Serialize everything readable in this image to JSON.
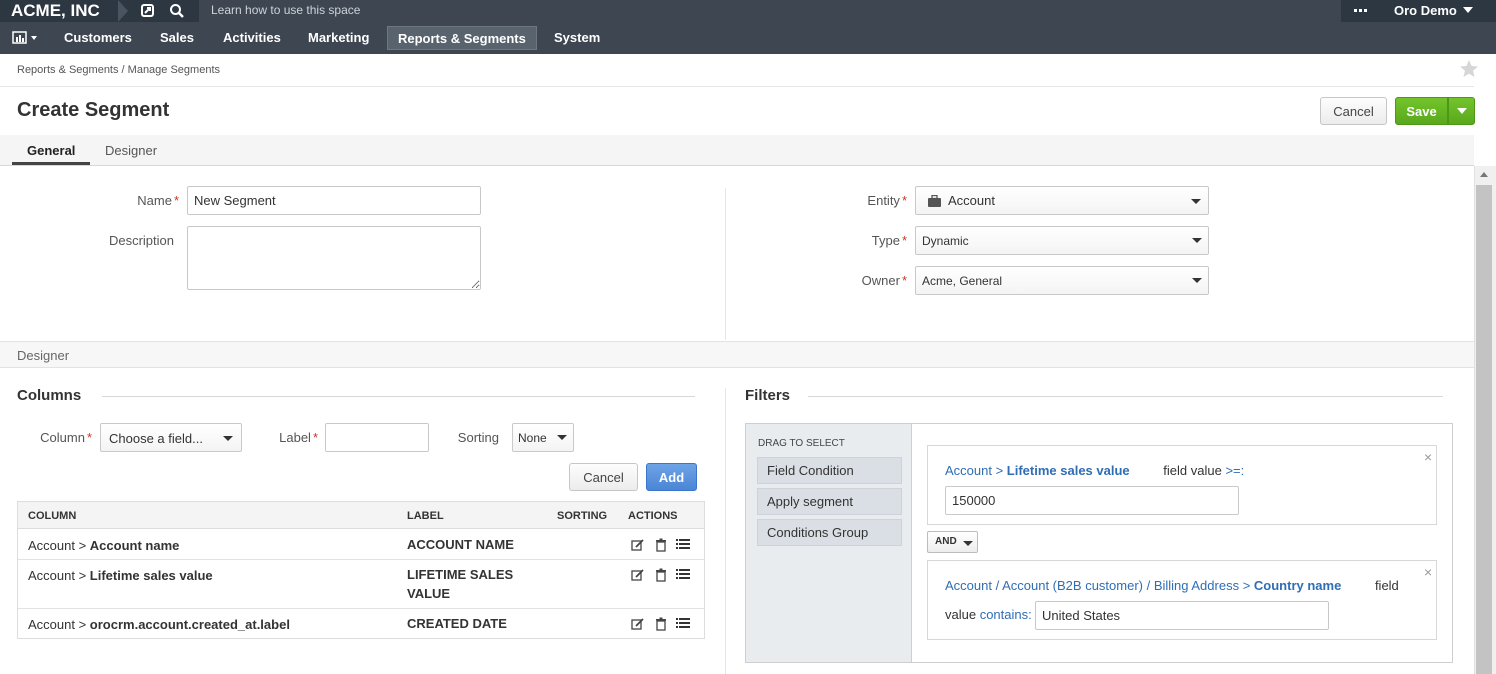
{
  "topbar": {
    "company": "ACME, INC",
    "search_placeholder": "Learn how to use this space",
    "user": "Oro Demo"
  },
  "nav": {
    "items": [
      "Customers",
      "Sales",
      "Activities",
      "Marketing",
      "Reports & Segments",
      "System"
    ],
    "active": "Reports & Segments"
  },
  "breadcrumb": "Reports & Segments / Manage Segments",
  "page": {
    "title": "Create Segment",
    "cancel_label": "Cancel",
    "save_label": "Save"
  },
  "tabs": [
    "General",
    "Designer"
  ],
  "general": {
    "name_label": "Name",
    "name_value": "New Segment",
    "description_label": "Description",
    "description_value": "",
    "entity_label": "Entity",
    "entity_value": "Account",
    "type_label": "Type",
    "type_value": "Dynamic",
    "owner_label": "Owner",
    "owner_value": "Acme, General"
  },
  "designer": {
    "section_title": "Designer",
    "columns_title": "Columns",
    "column_label": "Column",
    "column_placeholder": "Choose a field...",
    "label_label": "Label",
    "label_value": "",
    "sorting_label": "Sorting",
    "sorting_value": "None",
    "cancel_label": "Cancel",
    "add_label": "Add",
    "table_headers": [
      "COLUMN",
      "LABEL",
      "SORTING",
      "ACTIONS"
    ],
    "rows": [
      {
        "prefix": "Account > ",
        "field": "Account name",
        "label": "ACCOUNT NAME",
        "sorting": ""
      },
      {
        "prefix": "Account > ",
        "field": "Lifetime sales value",
        "label": "LIFETIME SALES VALUE",
        "sorting": ""
      },
      {
        "prefix": "Account > ",
        "field": "orocrm.account.created_at.label",
        "label": "CREATED DATE",
        "sorting": ""
      }
    ]
  },
  "filters": {
    "title": "Filters",
    "drag_label": "DRAG TO SELECT",
    "tools": [
      "Field Condition",
      "Apply segment",
      "Conditions Group"
    ],
    "condition1": {
      "path": "Account > ",
      "field": "Lifetime sales value",
      "text": "field value",
      "operator": ">=:",
      "value": "150000"
    },
    "operator": "AND",
    "condition2": {
      "path": "Account / Account (B2B customer) / Billing Address > ",
      "field": "Country name",
      "text1": "field",
      "text2": "value",
      "operator": "contains:",
      "value": "United States"
    }
  }
}
